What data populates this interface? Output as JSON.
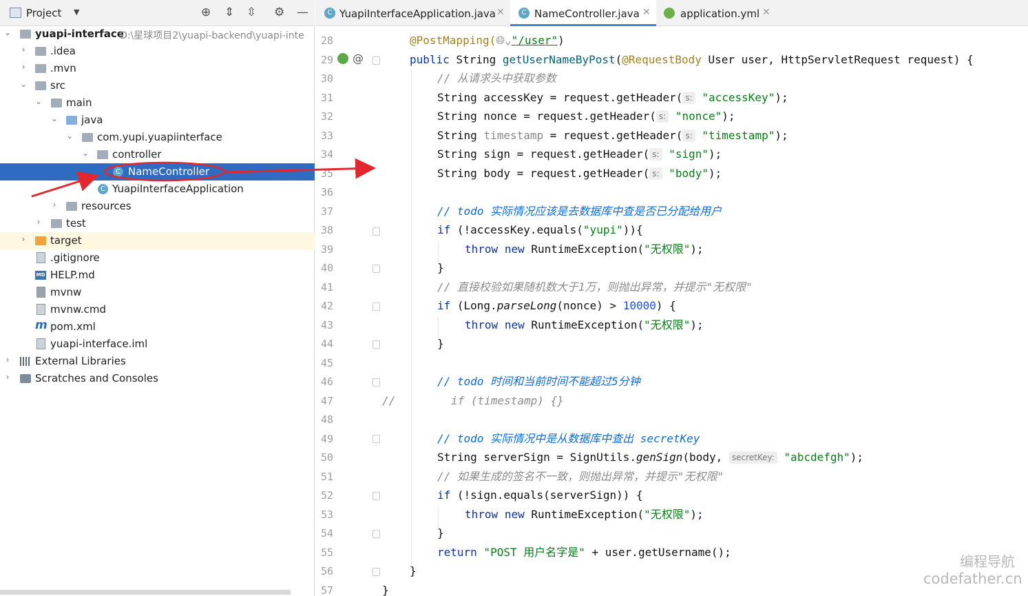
{
  "project_panel": {
    "title": "Project",
    "tree": [
      {
        "label": "yuapi-interface",
        "path": "D:\\星球项目2\\yuapi-backend\\yuapi-inte"
      },
      {
        "label": ".idea"
      },
      {
        "label": ".mvn"
      },
      {
        "label": "src"
      },
      {
        "label": "main"
      },
      {
        "label": "java"
      },
      {
        "label": "com.yupi.yuapiinterface"
      },
      {
        "label": "controller"
      },
      {
        "label": "NameController",
        "icon_text": "C"
      },
      {
        "label": "YuapiInterfaceApplication",
        "icon_text": "C"
      },
      {
        "label": "resources"
      },
      {
        "label": "test"
      },
      {
        "label": "target"
      },
      {
        "label": ".gitignore"
      },
      {
        "label": "HELP.md",
        "icon_text": "MD"
      },
      {
        "label": "mvnw"
      },
      {
        "label": "mvnw.cmd"
      },
      {
        "label": "pom.xml",
        "icon_text": "m"
      },
      {
        "label": "yuapi-interface.iml"
      },
      {
        "label": "External Libraries"
      },
      {
        "label": "Scratches and Consoles"
      }
    ]
  },
  "editor_tabs": [
    {
      "label": "YuapiInterfaceApplication.java",
      "icon_text": "C",
      "active": false
    },
    {
      "label": "NameController.java",
      "icon_text": "C",
      "active": true
    },
    {
      "label": "application.yml",
      "icon_text": "",
      "active": false
    }
  ],
  "gutter_line_numbers": [
    "28",
    "29",
    "30",
    "31",
    "32",
    "33",
    "34",
    "35",
    "36",
    "37",
    "38",
    "39",
    "40",
    "41",
    "42",
    "43",
    "44",
    "45",
    "46",
    "47",
    "48",
    "49",
    "50",
    "51",
    "52",
    "53",
    "54",
    "55",
    "56",
    "57"
  ],
  "code": {
    "l28": {
      "ann": "@PostMapping(",
      "path": "\"/user\"",
      "close": ")"
    },
    "l29": {
      "kw": "public",
      "t1": " String ",
      "fn": "getUserNameByPost",
      "t2": "(",
      "ann": "@RequestBody",
      "t3": " User user, HttpServletRequest request) {"
    },
    "l30": {
      "cm": "// 从请求头中获取参数"
    },
    "l31": {
      "t1": "String accessKey = request.getHeader(",
      "hint": "s:",
      "st": "\"accessKey\"",
      "t2": ");"
    },
    "l32": {
      "t1": "String nonce = request.getHeader(",
      "hint": "s:",
      "st": "\"nonce\"",
      "t2": ");"
    },
    "l33": {
      "t1": "String ",
      "dim": "timestamp",
      "t2": " = request.getHeader(",
      "hint": "s:",
      "st": "\"timestamp\"",
      "t3": ");"
    },
    "l34": {
      "t1": "String sign = request.getHeader(",
      "hint": "s:",
      "st": "\"sign\"",
      "t2": ");"
    },
    "l35": {
      "t1": "String body = request.getHeader(",
      "hint": "s:",
      "st": "\"body\"",
      "t2": ");"
    },
    "l37": {
      "c1": "// ",
      "todo": "todo",
      "c2": " 实际情况应该是去数据库中查是否已分配给用户"
    },
    "l38": {
      "kw": "if",
      "t1": " (!accessKey.equals(",
      "st": "\"yupi\"",
      "t2": ")){"
    },
    "l39": {
      "kw1": "throw",
      "kw2": "new",
      "t1": " RuntimeException(",
      "st": "\"无权限\"",
      "t2": ");"
    },
    "l40": {
      "t1": "}"
    },
    "l41": {
      "cm": "// 直接校验如果随机数大于1万，则抛出异常，并提示\"无权限\""
    },
    "l42": {
      "kw": "if",
      "t1": " (Long.",
      "it": "parseLong",
      "t2": "(nonce) > ",
      "nm": "10000",
      "t3": ") {"
    },
    "l43": {
      "kw1": "throw",
      "kw2": "new",
      "t1": " RuntimeException(",
      "st": "\"无权限\"",
      "t2": ");"
    },
    "l44": {
      "t1": "}"
    },
    "l46": {
      "c1": "// ",
      "todo": "todo",
      "c2": " 时间和当前时间不能超过5分钟"
    },
    "l47": {
      "prefix": "//",
      "cm": "if (timestamp) {}"
    },
    "l49": {
      "c1": "// ",
      "todo": "todo",
      "c2": " 实际情况中是从数据库中查出 secretKey"
    },
    "l50": {
      "t1": "String serverSign = SignUtils.",
      "it": "genSign",
      "t2": "(body, ",
      "hint": "secretKey:",
      "st": "\"abcdefgh\"",
      "t3": ");"
    },
    "l51": {
      "cm": "// 如果生成的签名不一致，则抛出异常，并提示\"无权限\""
    },
    "l52": {
      "kw": "if",
      "t1": " (!sign.equals(serverSign)) {"
    },
    "l53": {
      "kw1": "throw",
      "kw2": "new",
      "t1": " RuntimeException(",
      "st": "\"无权限\"",
      "t2": ");"
    },
    "l54": {
      "t1": "}"
    },
    "l55": {
      "kw": "return",
      "st": " \"POST 用户名字是\"",
      "t1": " + user.getUsername();"
    },
    "l56": {
      "t1": "}"
    },
    "l57": {
      "t1": "}"
    }
  },
  "watermark": {
    "line1": "编程导航",
    "line2": "codefather.cn"
  },
  "colors": {
    "selection": "#2f6bc1",
    "annotation_arrow": "#e0282e",
    "keyword": "#0c33a4",
    "string": "#067d17",
    "annotation": "#a0821a"
  }
}
